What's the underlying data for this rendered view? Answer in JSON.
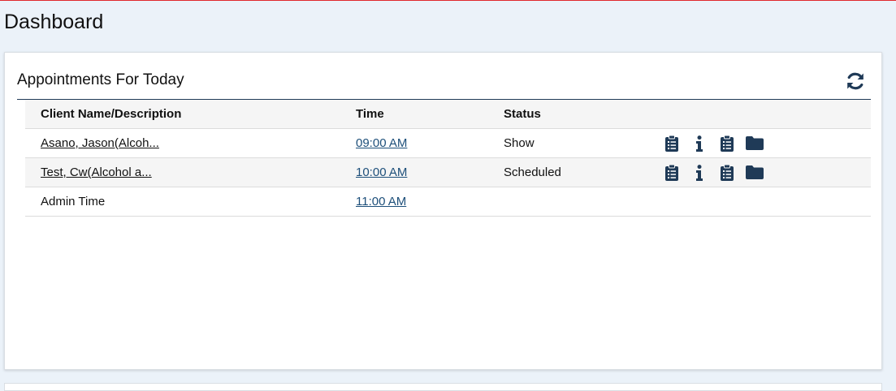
{
  "page": {
    "title": "Dashboard"
  },
  "widget": {
    "title": "Appointments For Today",
    "refresh_icon": "refresh-icon"
  },
  "table": {
    "columns": [
      "Client Name/Description",
      "Time",
      "Status"
    ],
    "rows": [
      {
        "name": "Asano, Jason(Alcoh...",
        "time": "09:00 AM",
        "status": "Show",
        "name_is_link": true,
        "has_icons": true
      },
      {
        "name": "Test, Cw(Alcohol a...",
        "time": "10:00 AM",
        "status": "Scheduled",
        "name_is_link": true,
        "has_icons": true
      },
      {
        "name": "Admin Time",
        "time": "11:00 AM",
        "status": "",
        "name_is_link": false,
        "has_icons": false
      }
    ],
    "row_icons": [
      "clipboard-list-icon",
      "info-icon",
      "clipboard-list-icon",
      "folder-icon"
    ]
  },
  "colors": {
    "accent": "#1f3a57",
    "link": "#1d4f7a",
    "top_border": "#e0282d",
    "page_bg": "#ebf2f9"
  }
}
